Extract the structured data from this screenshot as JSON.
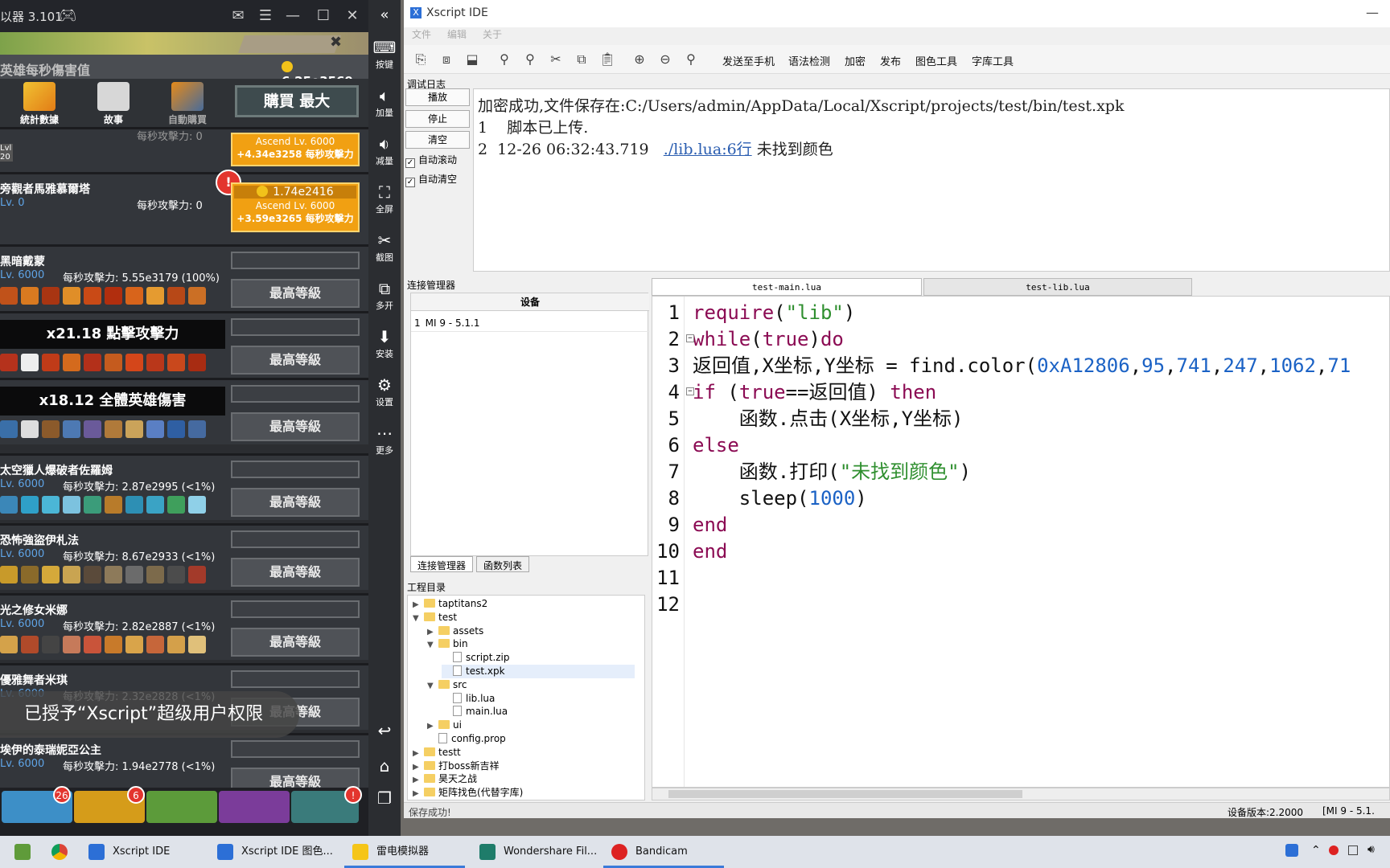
{
  "emulator": {
    "title": "以器 3.101",
    "dps_label": "英雄每秒傷害值",
    "gold": "6.25e3569",
    "tools": [
      "統計數據",
      "故事",
      "自動購買"
    ],
    "buy_max": "購買 最大",
    "ascend_line": "Ascend Lv. 6000",
    "heroes": [
      {
        "name": "",
        "lv": "",
        "dps": "每秒攻擊力: 0",
        "ascend_dps": "+4.34e3258 每秒攻擊力"
      },
      {
        "name": "旁觀者馬雅慕爾塔",
        "lv": "Lv. 0",
        "dps": "每秒攻擊力: 0",
        "cost": "1.74e2416",
        "ascend_dps": "+3.59e3265 每秒攻擊力"
      },
      {
        "name": "黑暗戴蒙",
        "lv": "Lv. 6000",
        "dps": "每秒攻擊力: 5.55e3179 (100%)",
        "btn": "最高等級"
      },
      {
        "boost": "x21.18 點擊攻擊力",
        "btn": "最高等級"
      },
      {
        "boost": "x18.12 全體英雄傷害",
        "btn": "最高等級"
      },
      {
        "name": "太空獵人爆破者佐羅姆",
        "lv": "Lv. 6000",
        "dps": "每秒攻擊力: 2.87e2995 (<1%)",
        "btn": "最高等級"
      },
      {
        "name": "恐怖強盜伊札法",
        "lv": "Lv. 6000",
        "dps": "每秒攻擊力: 8.67e2933 (<1%)",
        "btn": "最高等級"
      },
      {
        "name": "光之修女米娜",
        "lv": "Lv. 6000",
        "dps": "每秒攻擊力: 2.82e2887 (<1%)",
        "btn": "最高等級"
      },
      {
        "name": "優雅舞者米琪",
        "lv": "Lv. 6000",
        "dps": "每秒攻擊力: 2.32e2828 (<1%)",
        "btn": "最高等級"
      },
      {
        "name": "埃伊的泰瑞妮亞公主",
        "lv": "Lv. 6000",
        "dps": "每秒攻擊力: 1.94e2778 (<1%)",
        "btn": "最高等級"
      }
    ],
    "toast": "已授予“Xscript”超级用户权限",
    "bottom_badges": [
      "26",
      "6",
      "!"
    ],
    "sidebar": [
      "按键",
      "加量",
      "减量",
      "全屏",
      "截图",
      "多开",
      "安装",
      "设置",
      "更多"
    ]
  },
  "ide": {
    "title": "Xscript IDE",
    "menu": [
      "文件",
      "编辑",
      "关于"
    ],
    "toolbar_text": [
      "发送至手机",
      "语法检测",
      "加密",
      "发布",
      "图色工具",
      "字库工具"
    ],
    "debug_label": "调试日志",
    "debug_buttons": [
      "播放",
      "停止",
      "清空"
    ],
    "checkboxes": [
      "自动滚动",
      "自动清空"
    ],
    "log": {
      "line0": "加密成功,文件保存在:C:/Users/admin/AppData/Local/Xscript/projects/test/bin/test.xpk",
      "line1": "1    脚本已上传.",
      "line2_pre": "2  12-26 06:32:43.719   ",
      "line2_link": "./lib.lua:6行",
      "line2_post": " 未找到颜色"
    },
    "conn_label": "连接管理器",
    "device_header": "设备",
    "device": "MI 9 - 5.1.1",
    "device_index": "1",
    "conn_tabs": [
      "连接管理器",
      "函数列表"
    ],
    "project_label": "工程目录",
    "tree": [
      {
        "t": "taptitans2",
        "d": 0,
        "type": "folder",
        "arrow": "▶"
      },
      {
        "t": "test",
        "d": 0,
        "type": "folder",
        "arrow": "▼"
      },
      {
        "t": "assets",
        "d": 1,
        "type": "folder",
        "arrow": "▶"
      },
      {
        "t": "bin",
        "d": 1,
        "type": "folder",
        "arrow": "▼"
      },
      {
        "t": "script.zip",
        "d": 2,
        "type": "file",
        "arrow": ""
      },
      {
        "t": "test.xpk",
        "d": 2,
        "type": "file",
        "arrow": ""
      },
      {
        "t": "src",
        "d": 1,
        "type": "folder",
        "arrow": "▼"
      },
      {
        "t": "lib.lua",
        "d": 2,
        "type": "file",
        "arrow": ""
      },
      {
        "t": "main.lua",
        "d": 2,
        "type": "file",
        "arrow": ""
      },
      {
        "t": "ui",
        "d": 1,
        "type": "folder",
        "arrow": "▶"
      },
      {
        "t": "config.prop",
        "d": 1,
        "type": "file",
        "arrow": ""
      },
      {
        "t": "testt",
        "d": 0,
        "type": "folder",
        "arrow": "▶"
      },
      {
        "t": "打boss新吉祥",
        "d": 0,
        "type": "folder",
        "arrow": "▶"
      },
      {
        "t": "昊天之战",
        "d": 0,
        "type": "folder",
        "arrow": "▶"
      },
      {
        "t": "矩阵找色(代替字库)",
        "d": 0,
        "type": "folder",
        "arrow": "▶"
      }
    ],
    "editor_tabs": [
      "test-main.lua",
      "test-lib.lua"
    ],
    "line_numbers": [
      "1",
      "2",
      "3",
      "4",
      "5",
      "6",
      "7",
      "8",
      "9",
      "10",
      "11",
      "12"
    ],
    "status_left": "保存成功!",
    "status_version": "设备版本:2.2000",
    "status_device": "[MI 9 - 5.1."
  },
  "taskbar": [
    "Xscript IDE",
    "Xscript IDE 图色...",
    "雷电模拟器",
    "Wondershare Fil...",
    "Bandicam"
  ]
}
